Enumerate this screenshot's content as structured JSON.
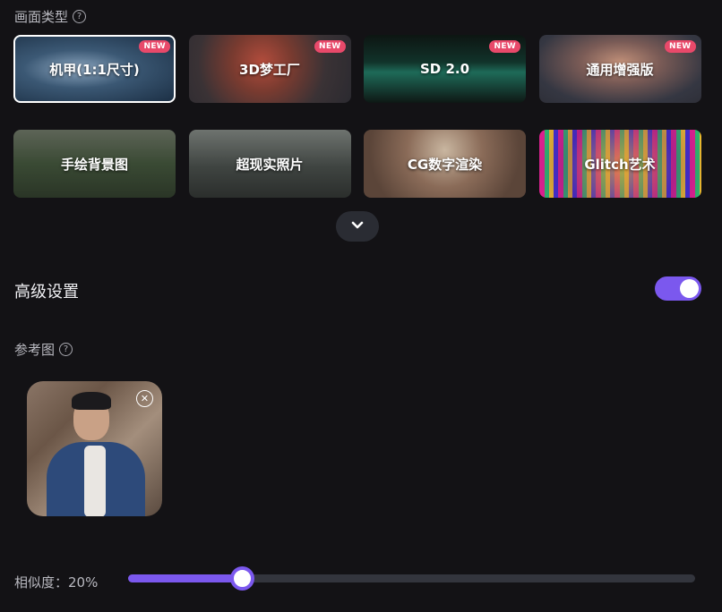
{
  "style_section": {
    "label": "画面类型",
    "tiles": [
      {
        "label": "机甲(1:1尺寸)",
        "badge": "NEW",
        "selected": true
      },
      {
        "label": "3D梦工厂",
        "badge": "NEW"
      },
      {
        "label": "SD 2.0",
        "badge": "NEW"
      },
      {
        "label": "通用增强版",
        "badge": "NEW"
      },
      {
        "label": "手绘背景图"
      },
      {
        "label": "超现实照片"
      },
      {
        "label": "CG数字渲染"
      },
      {
        "label": "Glitch艺术"
      }
    ],
    "expand_icon": "chevron-down-icon"
  },
  "advanced": {
    "title": "高级设置",
    "enabled": true,
    "accent_color": "#7b58ee"
  },
  "reference": {
    "label": "参考图",
    "remove_icon": "close-circle-icon"
  },
  "similarity": {
    "label": "相似度：20%",
    "value": 0.2
  }
}
